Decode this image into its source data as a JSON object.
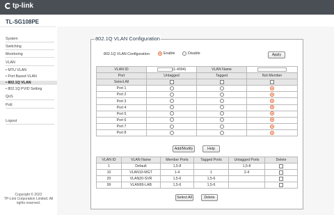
{
  "brand": {
    "logo_text": "tp-link"
  },
  "model": "TL-SG108PE",
  "sidebar": {
    "items": [
      {
        "label": "System"
      },
      {
        "label": "Switching"
      },
      {
        "label": "Monitoring"
      },
      {
        "label": "VLAN"
      },
      {
        "label": "• MTU VLAN"
      },
      {
        "label": "• Port Based VLAN"
      },
      {
        "label": "• 802.1Q VLAN"
      },
      {
        "label": "• 802.1Q PVID Setting"
      },
      {
        "label": "QoS"
      },
      {
        "label": "PoE"
      },
      {
        "label": "Logout"
      }
    ],
    "copyright_line1": "Copyright © 2022",
    "copyright_line2": "TP-Link Corporation Limited. All",
    "copyright_line3": "rights reserved."
  },
  "panel": {
    "title": "802.1Q VLAN Configuration",
    "config_label": "802.1Q VLAN Configuration:",
    "enable_label": "Enable",
    "disable_label": "Disable",
    "enabled": true,
    "apply_label": "Apply"
  },
  "vlan_form": {
    "vlan_id_label": "VLAN ID",
    "vlan_id_value": "",
    "vlan_id_hint": "(1-4094)",
    "vlan_name_label": "VLAN Name",
    "vlan_name_value": "",
    "col_port": "Port",
    "col_untagged": "Untagged",
    "col_tagged": "Tagged",
    "col_not_member": "Not Member",
    "select_all": "Select All",
    "ports": [
      "Port 1",
      "Port 2",
      "Port 3",
      "Port 4",
      "Port 5",
      "Port 6",
      "Port 7",
      "Port 8"
    ],
    "port_selection": [
      "not_member",
      "not_member",
      "not_member",
      "not_member",
      "not_member",
      "not_member",
      "not_member",
      "not_member"
    ],
    "add_modify_label": "Add/Modify",
    "help_label": "Help"
  },
  "vlan_table": {
    "headers": [
      "VLAN ID",
      "VLAN Name",
      "Member Ports",
      "Tagged Ports",
      "Untagged Ports",
      "Delete"
    ],
    "rows": [
      {
        "id": "1",
        "name": "Default",
        "member": "1,5-8",
        "tagged": "",
        "untagged": "1,5-8"
      },
      {
        "id": "10",
        "name": "VLAN10-MGT",
        "member": "1-4",
        "tagged": "1",
        "untagged": "2-4"
      },
      {
        "id": "20",
        "name": "VLAN20-SVR",
        "member": "1,5-6",
        "tagged": "1,5-6",
        "untagged": ""
      },
      {
        "id": "99",
        "name": "VLAN99-LAB",
        "member": "1,5-6",
        "tagged": "1,5-6",
        "untagged": ""
      }
    ],
    "select_all_label": "Select All",
    "delete_label": "Delete"
  },
  "colors": {
    "topbar": "#4a4f55",
    "accent_radio": "#e25f2a"
  }
}
